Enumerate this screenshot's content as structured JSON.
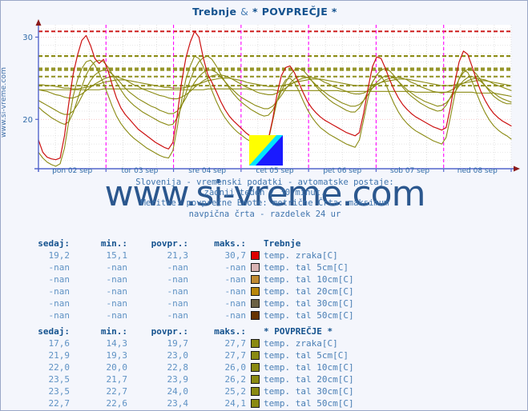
{
  "site": {
    "vertical_label": "www.si-vreme.com",
    "watermark": "www.si-vreme.com"
  },
  "header": {
    "title_station": "Trebnje",
    "title_sep": "&",
    "title_average": "* POVPREČJE *"
  },
  "caption": {
    "line1": "Slovenija - vremenski podatki - avtomatske postaje:",
    "line2": "zadnji teden / 30 minut.",
    "line3": "Meritve: povprečne  Enote: metrične  Črta: maksimum",
    "line4": "navpična črta - razdelek 24 ur"
  },
  "chart_data": {
    "type": "line",
    "title": "Trebnje & * POVPREČJE *",
    "xlabel": "",
    "ylabel": "",
    "ylim": [
      14,
      31.5
    ],
    "yticks": [
      20,
      30
    ],
    "ytick_labels": [
      "20",
      "30"
    ],
    "grid": true,
    "legend_position": "below-table",
    "x_tick_labels": [
      "pon 02 sep",
      "tor 03 sep",
      "sre 04 sep",
      "cet 05 sep",
      "pet 06 sep",
      "sob 07 sep",
      "ned 08 sep"
    ],
    "x_day_separator_note": "navpična črta - razdelek 24 ur",
    "series": [
      {
        "name": "Trebnje temp. zraka[C]",
        "color": "#cc1111",
        "values": [
          17.5,
          16.0,
          15.4,
          15.2,
          15.1,
          15.3,
          18.0,
          22.0,
          25.5,
          27.8,
          29.6,
          30.2,
          29.0,
          27.4,
          26.8,
          27.3,
          26.0,
          24.2,
          22.6,
          21.4,
          20.6,
          20.0,
          19.4,
          18.8,
          18.4,
          18.0,
          17.6,
          17.2,
          16.9,
          16.6,
          16.4,
          17.2,
          20.5,
          24.5,
          27.5,
          29.4,
          30.7,
          30.0,
          27.5,
          25.5,
          24.5,
          23.4,
          22.2,
          21.2,
          20.4,
          19.8,
          19.3,
          18.8,
          18.3,
          17.9,
          17.5,
          17.1,
          16.8,
          17.6,
          20.0,
          23.0,
          25.3,
          26.3,
          26.5,
          25.7,
          24.5,
          23.3,
          22.2,
          21.4,
          20.8,
          20.3,
          19.9,
          19.6,
          19.3,
          19.0,
          18.7,
          18.4,
          18.2,
          18.0,
          18.4,
          20.8,
          23.8,
          26.4,
          27.6,
          27.4,
          26.2,
          24.8,
          23.6,
          22.6,
          21.8,
          21.2,
          20.7,
          20.3,
          20.0,
          19.7,
          19.4,
          19.1,
          18.9,
          18.7,
          19.0,
          21.5,
          24.5,
          27.0,
          28.3,
          27.9,
          26.4,
          24.8,
          23.4,
          22.3,
          21.4,
          20.7,
          20.2,
          19.8,
          19.5,
          19.2
        ]
      },
      {
        "name": "* POVPREČJE * temp. zraka[C]",
        "color": "#8a8a12",
        "values": [
          16.0,
          15.3,
          14.8,
          14.5,
          14.3,
          14.6,
          16.5,
          19.8,
          22.8,
          24.8,
          26.2,
          27.0,
          27.2,
          26.6,
          25.6,
          24.4,
          23.0,
          21.6,
          20.4,
          19.5,
          18.8,
          18.2,
          17.7,
          17.3,
          16.9,
          16.5,
          16.2,
          15.9,
          15.6,
          15.4,
          15.3,
          16.2,
          19.0,
          22.3,
          24.9,
          26.5,
          27.7,
          27.4,
          26.4,
          25.0,
          23.5,
          22.2,
          21.1,
          20.2,
          19.5,
          18.9,
          18.4,
          18.0,
          17.6,
          17.3,
          17.0,
          16.7,
          16.5,
          17.4,
          19.8,
          22.2,
          23.9,
          24.8,
          25.0,
          24.5,
          23.5,
          22.3,
          21.2,
          20.3,
          19.6,
          19.0,
          18.6,
          18.2,
          17.9,
          17.6,
          17.3,
          17.0,
          16.8,
          16.6,
          17.5,
          20.0,
          22.6,
          24.5,
          25.4,
          25.3,
          24.4,
          23.1,
          21.9,
          20.9,
          20.1,
          19.5,
          19.0,
          18.6,
          18.3,
          18.0,
          17.7,
          17.4,
          17.2,
          17.0,
          17.8,
          20.3,
          23.0,
          25.0,
          26.0,
          25.7,
          24.6,
          23.2,
          21.9,
          20.8,
          19.9,
          19.2,
          18.7,
          18.3,
          18.0,
          17.6
        ]
      },
      {
        "name": "* POVPREČJE * temp. tal 5cm[C]",
        "color": "#8a8a12",
        "values": [
          21.5,
          21.0,
          20.6,
          20.2,
          19.9,
          19.6,
          19.4,
          19.7,
          20.8,
          22.4,
          24.0,
          25.4,
          26.4,
          27.0,
          27.2,
          27.0,
          26.4,
          25.5,
          24.5,
          23.6,
          22.8,
          22.2,
          21.7,
          21.3,
          20.9,
          20.6,
          20.3,
          20.0,
          19.7,
          19.5,
          19.3,
          19.4,
          20.2,
          21.6,
          23.2,
          24.8,
          26.1,
          27.0,
          27.5,
          27.7,
          27.3,
          26.5,
          25.5,
          24.6,
          23.8,
          23.1,
          22.5,
          22.0,
          21.6,
          21.2,
          20.9,
          20.6,
          20.4,
          20.5,
          21.1,
          22.2,
          23.4,
          24.5,
          25.4,
          26.0,
          26.2,
          26.0,
          25.4,
          24.7,
          24.0,
          23.4,
          22.9,
          22.4,
          22.0,
          21.7,
          21.4,
          21.1,
          20.9,
          20.9,
          21.4,
          22.3,
          23.4,
          24.5,
          25.4,
          26.0,
          26.2,
          25.9,
          25.3,
          24.6,
          23.9,
          23.3,
          22.8,
          22.4,
          22.0,
          21.7,
          21.4,
          21.2,
          21.0,
          21.1,
          21.7,
          22.7,
          23.8,
          24.9,
          25.7,
          26.1,
          26.0,
          25.5,
          24.8,
          24.1,
          23.4,
          22.8,
          22.4,
          22.1,
          21.9,
          21.9
        ]
      },
      {
        "name": "* POVPREČJE * temp. tal 10cm[C]",
        "color": "#8a8a12",
        "values": [
          22.3,
          22.0,
          21.7,
          21.4,
          21.1,
          20.8,
          20.6,
          20.6,
          21.0,
          21.8,
          22.8,
          23.8,
          24.7,
          25.4,
          25.8,
          26.0,
          25.9,
          25.5,
          25.0,
          24.4,
          23.8,
          23.3,
          22.9,
          22.5,
          22.2,
          21.9,
          21.6,
          21.4,
          21.1,
          20.9,
          20.7,
          20.7,
          21.0,
          21.7,
          22.6,
          23.6,
          24.5,
          25.2,
          25.7,
          26.0,
          26.0,
          25.7,
          25.2,
          24.6,
          24.0,
          23.5,
          23.0,
          22.6,
          22.3,
          22.0,
          21.7,
          21.5,
          21.3,
          21.3,
          21.6,
          22.2,
          22.9,
          23.7,
          24.4,
          24.9,
          25.2,
          25.3,
          25.1,
          24.7,
          24.2,
          23.7,
          23.3,
          22.9,
          22.6,
          22.3,
          22.0,
          21.8,
          21.6,
          21.6,
          21.8,
          22.3,
          23.0,
          23.8,
          24.5,
          25.0,
          25.3,
          25.3,
          25.0,
          24.6,
          24.1,
          23.6,
          23.2,
          22.8,
          22.5,
          22.2,
          22.0,
          21.8,
          21.6,
          21.7,
          22.0,
          22.6,
          23.3,
          24.1,
          24.7,
          25.1,
          25.2,
          25.0,
          24.6,
          24.1,
          23.6,
          23.2,
          22.8,
          22.5,
          22.3,
          22.1
        ]
      },
      {
        "name": "* POVPREČJE * temp. tal 20cm[C]",
        "color": "#8a8a12",
        "values": [
          23.6,
          23.5,
          23.4,
          23.2,
          23.0,
          22.9,
          22.7,
          22.6,
          22.6,
          22.8,
          23.1,
          23.5,
          23.9,
          24.3,
          24.6,
          24.9,
          25.1,
          25.2,
          25.2,
          25.0,
          24.8,
          24.5,
          24.2,
          24.0,
          23.7,
          23.5,
          23.3,
          23.1,
          22.9,
          22.8,
          22.6,
          22.5,
          22.5,
          22.7,
          23.0,
          23.4,
          23.9,
          24.3,
          24.7,
          25.0,
          25.3,
          25.4,
          25.4,
          25.3,
          25.1,
          24.8,
          24.5,
          24.2,
          23.9,
          23.7,
          23.4,
          23.2,
          23.1,
          23.0,
          23.0,
          23.2,
          23.5,
          23.8,
          24.2,
          24.5,
          24.8,
          25.0,
          25.1,
          25.1,
          25.0,
          24.8,
          24.5,
          24.3,
          24.0,
          23.8,
          23.6,
          23.4,
          23.2,
          23.1,
          23.1,
          23.2,
          23.5,
          23.8,
          24.2,
          24.5,
          24.8,
          25.0,
          25.1,
          25.1,
          25.0,
          24.8,
          24.5,
          24.3,
          24.0,
          23.8,
          23.6,
          23.4,
          23.3,
          23.2,
          23.3,
          23.5,
          23.8,
          24.1,
          24.4,
          24.7,
          24.9,
          25.0,
          24.9,
          24.8,
          24.6,
          24.3,
          24.1,
          23.9,
          23.7,
          23.5
        ]
      },
      {
        "name": "* POVPREČJE * temp. tal 30cm[C]",
        "color": "#8a8a12",
        "values": [
          24.2,
          24.2,
          24.1,
          24.1,
          24.0,
          23.9,
          23.8,
          23.8,
          23.7,
          23.7,
          23.8,
          23.9,
          24.0,
          24.2,
          24.3,
          24.5,
          24.6,
          24.7,
          24.8,
          24.8,
          24.8,
          24.7,
          24.6,
          24.5,
          24.4,
          24.3,
          24.2,
          24.1,
          24.0,
          23.9,
          23.9,
          23.8,
          23.8,
          23.8,
          23.9,
          24.0,
          24.2,
          24.3,
          24.5,
          24.7,
          24.8,
          24.9,
          25.0,
          25.0,
          25.0,
          24.9,
          24.8,
          24.7,
          24.5,
          24.4,
          24.3,
          24.2,
          24.1,
          24.0,
          24.0,
          24.0,
          24.1,
          24.2,
          24.3,
          24.5,
          24.6,
          24.7,
          24.8,
          24.9,
          24.9,
          24.9,
          24.8,
          24.7,
          24.6,
          24.5,
          24.4,
          24.3,
          24.2,
          24.1,
          24.1,
          24.1,
          24.1,
          24.2,
          24.3,
          24.5,
          24.6,
          24.7,
          24.8,
          24.9,
          24.9,
          24.9,
          24.8,
          24.7,
          24.6,
          24.5,
          24.4,
          24.3,
          24.2,
          24.1,
          24.1,
          24.1,
          24.2,
          24.3,
          24.4,
          24.5,
          24.6,
          24.7,
          24.7,
          24.7,
          24.6,
          24.5,
          24.4,
          24.3,
          24.2,
          24.1
        ]
      },
      {
        "name": "* POVPREČJE * temp. tal 50cm[C]",
        "color": "#8a8a12",
        "values": [
          23.6,
          23.6,
          23.6,
          23.6,
          23.6,
          23.6,
          23.6,
          23.6,
          23.6,
          23.6,
          23.6,
          23.6,
          23.6,
          23.6,
          23.6,
          23.7,
          23.7,
          23.7,
          23.7,
          23.7,
          23.7,
          23.7,
          23.7,
          23.7,
          23.7,
          23.7,
          23.7,
          23.6,
          23.6,
          23.6,
          23.6,
          23.6,
          23.6,
          23.6,
          23.6,
          23.6,
          23.6,
          23.6,
          23.6,
          23.7,
          23.7,
          23.7,
          23.7,
          23.7,
          23.7,
          23.7,
          23.7,
          23.7,
          23.7,
          23.6,
          23.6,
          23.6,
          23.6,
          23.6,
          23.6,
          23.5,
          23.5,
          23.5,
          23.5,
          23.5,
          23.5,
          23.5,
          23.5,
          23.5,
          23.5,
          23.5,
          23.5,
          23.5,
          23.5,
          23.5,
          23.4,
          23.4,
          23.4,
          23.4,
          23.4,
          23.4,
          23.4,
          23.4,
          23.4,
          23.4,
          23.4,
          23.4,
          23.4,
          23.4,
          23.4,
          23.4,
          23.4,
          23.3,
          23.3,
          23.3,
          23.3,
          23.3,
          23.3,
          23.3,
          23.3,
          23.3,
          23.3,
          23.3,
          23.3,
          23.3,
          23.3,
          23.2,
          23.2,
          23.2,
          23.2,
          23.2,
          23.1,
          23.0,
          22.9,
          22.8
        ]
      }
    ],
    "max_lines": [
      {
        "label": "Trebnje temp. zraka max",
        "value": 30.7,
        "color": "#cc1111",
        "style": "dashed"
      },
      {
        "label": "* POVPREČJE * temp. zraka max",
        "value": 27.7,
        "color": "#8a8a12",
        "style": "dashed"
      },
      {
        "label": "* POVPREČJE * temp. tal 5cm max",
        "value": 27.7,
        "color": "#8a8a12",
        "style": "dashed"
      },
      {
        "label": "* POVPREČJE * temp. tal 10cm max",
        "value": 26.0,
        "color": "#8a8a12",
        "style": "dashed"
      },
      {
        "label": "* POVPREČJE * temp. tal 20cm max",
        "value": 26.2,
        "color": "#8a8a12",
        "style": "dashed"
      },
      {
        "label": "* POVPREČJE * temp. tal 30cm max",
        "value": 25.2,
        "color": "#8a8a12",
        "style": "dashed"
      },
      {
        "label": "* POVPREČJE * temp. tal 50cm max",
        "value": 24.1,
        "color": "#8a8a12",
        "style": "dashed"
      }
    ]
  },
  "table_trebnje": {
    "headers": {
      "sedaj": "sedaj:",
      "min": "min.:",
      "povpr": "povpr.:",
      "maks": "maks.:",
      "group": "Trebnje"
    },
    "rows": [
      {
        "sedaj": "19,2",
        "min": "15,1",
        "povpr": "21,3",
        "maks": "30,7",
        "color": "#e00000",
        "name": "temp. zraka[C]"
      },
      {
        "sedaj": "-nan",
        "min": "-nan",
        "povpr": "-nan",
        "maks": "-nan",
        "color": "#d9b3b3",
        "name": "temp. tal  5cm[C]"
      },
      {
        "sedaj": "-nan",
        "min": "-nan",
        "povpr": "-nan",
        "maks": "-nan",
        "color": "#c08a33",
        "name": "temp. tal 10cm[C]"
      },
      {
        "sedaj": "-nan",
        "min": "-nan",
        "povpr": "-nan",
        "maks": "-nan",
        "color": "#b8860b",
        "name": "temp. tal 20cm[C]"
      },
      {
        "sedaj": "-nan",
        "min": "-nan",
        "povpr": "-nan",
        "maks": "-nan",
        "color": "#6b6145",
        "name": "temp. tal 30cm[C]"
      },
      {
        "sedaj": "-nan",
        "min": "-nan",
        "povpr": "-nan",
        "maks": "-nan",
        "color": "#663300",
        "name": "temp. tal 50cm[C]"
      }
    ]
  },
  "table_povprecje": {
    "headers": {
      "sedaj": "sedaj:",
      "min": "min.:",
      "povpr": "povpr.:",
      "maks": "maks.:",
      "group": "* POVPREČJE *"
    },
    "rows": [
      {
        "sedaj": "17,6",
        "min": "14,3",
        "povpr": "19,7",
        "maks": "27,7",
        "color": "#8a8a12",
        "name": "temp. zraka[C]"
      },
      {
        "sedaj": "21,9",
        "min": "19,3",
        "povpr": "23,0",
        "maks": "27,7",
        "color": "#8a8a12",
        "name": "temp. tal  5cm[C]"
      },
      {
        "sedaj": "22,0",
        "min": "20,0",
        "povpr": "22,8",
        "maks": "26,0",
        "color": "#8a8a12",
        "name": "temp. tal 10cm[C]"
      },
      {
        "sedaj": "23,5",
        "min": "21,7",
        "povpr": "23,9",
        "maks": "26,2",
        "color": "#8a8a12",
        "name": "temp. tal 20cm[C]"
      },
      {
        "sedaj": "23,5",
        "min": "22,7",
        "povpr": "24,0",
        "maks": "25,2",
        "color": "#8a8a12",
        "name": "temp. tal 30cm[C]"
      },
      {
        "sedaj": "22,7",
        "min": "22,6",
        "povpr": "23,4",
        "maks": "24,1",
        "color": "#8a8a12",
        "name": "temp. tal 50cm[C]"
      }
    ]
  },
  "logo": {
    "name": "si-vreme-logo",
    "color_top": "#ffff00",
    "color_band": "#00e5ff",
    "color_bottom": "#1a1aff"
  }
}
